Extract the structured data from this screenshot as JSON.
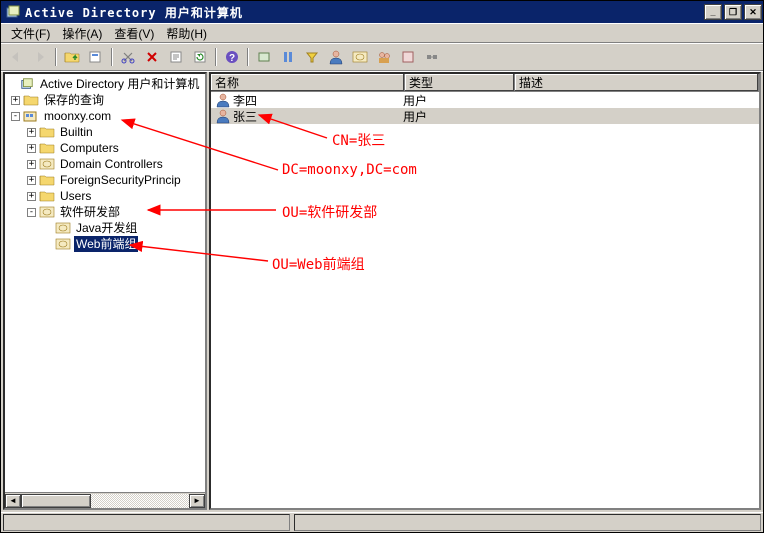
{
  "window": {
    "title": "Active Directory 用户和计算机"
  },
  "menu": {
    "file": "文件(F)",
    "action": "操作(A)",
    "view": "查看(V)",
    "help": "帮助(H)"
  },
  "wbtns": {
    "min": "_",
    "max": "❐",
    "close": "✕"
  },
  "toolbar_icons": [
    "back-icon",
    "forward-icon",
    "up-icon",
    "sep",
    "folder-icon",
    "find-folder-icon",
    "sep",
    "cut-icon",
    "delete-icon",
    "properties-icon",
    "refresh-icon",
    "sep",
    "help-icon",
    "sep",
    "filter-icon",
    "user-icon",
    "computer-icon",
    "group-icon",
    "ou-icon",
    "report-icon"
  ],
  "tree": {
    "root": {
      "label": "Active Directory 用户和计算机"
    },
    "saved": {
      "label": "保存的查询"
    },
    "domain": {
      "label": "moonxy.com"
    },
    "domain_children": [
      {
        "label": "Builtin"
      },
      {
        "label": "Computers"
      },
      {
        "label": "Domain Controllers"
      },
      {
        "label": "ForeignSecurityPrincip"
      },
      {
        "label": "Users"
      }
    ],
    "ou_root": {
      "label": "软件研发部"
    },
    "ou_children": [
      {
        "label": "Java开发组"
      },
      {
        "label": "Web前端组"
      }
    ]
  },
  "columns": {
    "name": "名称",
    "type": "类型",
    "desc": "描述"
  },
  "rows": [
    {
      "name": "李四",
      "type": "用户"
    },
    {
      "name": "张三",
      "type": "用户"
    }
  ],
  "annotations": {
    "a1": "CN=张三",
    "a2": "DC=moonxy,DC=com",
    "a3": "OU=软件研发部",
    "a4": "OU=Web前端组"
  }
}
